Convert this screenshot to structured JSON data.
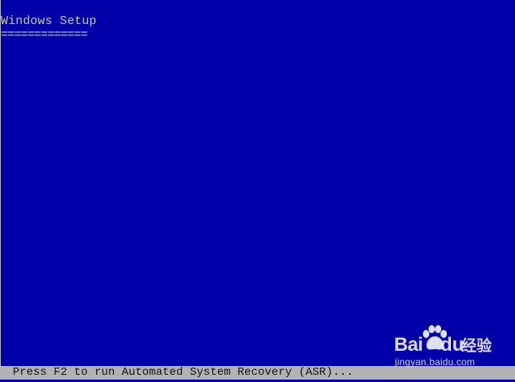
{
  "window": {
    "title": "Windows Setup",
    "title_underline": "============="
  },
  "status_bar": {
    "message": "Press F2 to run Automated System Recovery (ASR)..."
  },
  "watermark": {
    "brand_left": "Bai",
    "brand_right": "du",
    "brand_cn": "经验",
    "url": "jingyan.baidu.com",
    "icon": "paw-icon"
  },
  "colors": {
    "background": "#0000a8",
    "text": "#c8c8c8",
    "status_bar": "#b2b2b2",
    "status_text": "#101010"
  }
}
